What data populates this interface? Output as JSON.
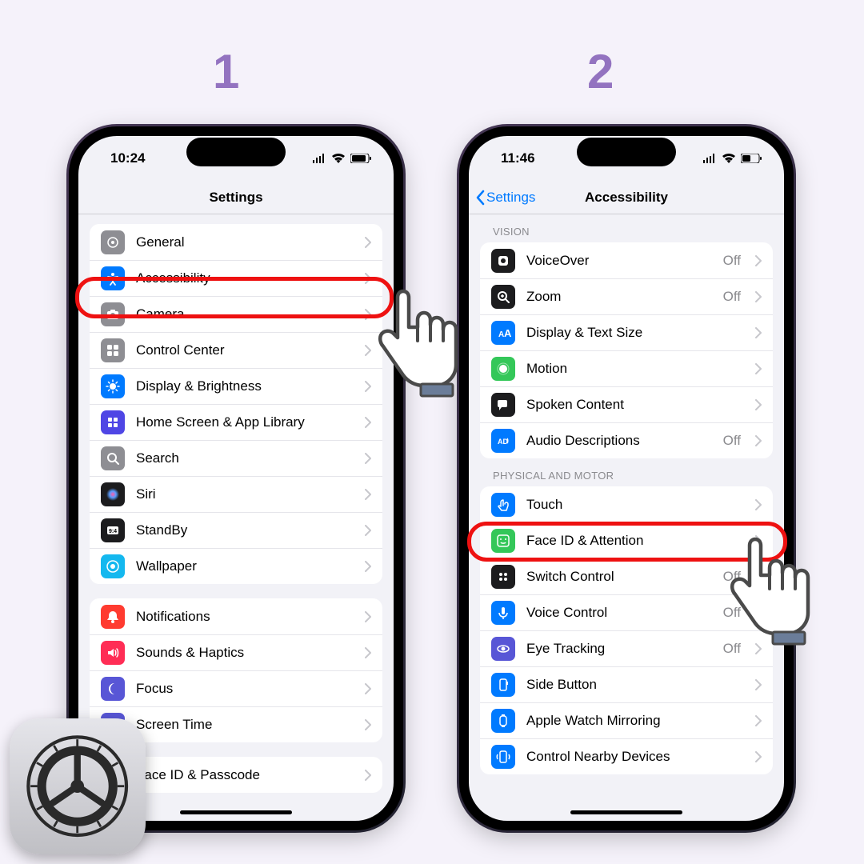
{
  "steps": {
    "one": "1",
    "two": "2"
  },
  "phone1": {
    "time": "10:24",
    "title": "Settings",
    "rows1": [
      {
        "label": "General",
        "iconColor": "#8e8e93"
      },
      {
        "label": "Accessibility",
        "iconColor": "#007aff",
        "highlighted": true
      },
      {
        "label": "Camera",
        "iconColor": "#8e8e93"
      },
      {
        "label": "Control Center",
        "iconColor": "#8e8e93"
      },
      {
        "label": "Display & Brightness",
        "iconColor": "#007aff"
      },
      {
        "label": "Home Screen & App Library",
        "iconColor": "#4f46e5"
      },
      {
        "label": "Search",
        "iconColor": "#8e8e93"
      },
      {
        "label": "Siri",
        "iconColor": "#1c1c1e"
      },
      {
        "label": "StandBy",
        "iconColor": "#1c1c1e"
      },
      {
        "label": "Wallpaper",
        "iconColor": "#14b8ef"
      }
    ],
    "rows2": [
      {
        "label": "Notifications",
        "iconColor": "#ff3b30"
      },
      {
        "label": "Sounds & Haptics",
        "iconColor": "#ff2d55"
      },
      {
        "label": "Focus",
        "iconColor": "#5856d6"
      },
      {
        "label": "Screen Time",
        "iconColor": "#5856d6"
      }
    ],
    "rows3": [
      {
        "label": "Face ID & Passcode",
        "iconColor": "#34c759"
      }
    ]
  },
  "phone2": {
    "time": "11:46",
    "back": "Settings",
    "title": "Accessibility",
    "visionHeader": "VISION",
    "visionRows": [
      {
        "label": "VoiceOver",
        "value": "Off",
        "iconColor": "#1c1c1e"
      },
      {
        "label": "Zoom",
        "value": "Off",
        "iconColor": "#1c1c1e"
      },
      {
        "label": "Display & Text Size",
        "value": "",
        "iconColor": "#007aff"
      },
      {
        "label": "Motion",
        "value": "",
        "iconColor": "#34c759"
      },
      {
        "label": "Spoken Content",
        "value": "",
        "iconColor": "#1c1c1e"
      },
      {
        "label": "Audio Descriptions",
        "value": "Off",
        "iconColor": "#007aff"
      }
    ],
    "motorHeader": "PHYSICAL AND MOTOR",
    "motorRows": [
      {
        "label": "Touch",
        "value": "",
        "iconColor": "#007aff",
        "highlighted": true
      },
      {
        "label": "Face ID & Attention",
        "value": "",
        "iconColor": "#34c759"
      },
      {
        "label": "Switch Control",
        "value": "Off",
        "iconColor": "#1c1c1e"
      },
      {
        "label": "Voice Control",
        "value": "Off",
        "iconColor": "#007aff"
      },
      {
        "label": "Eye Tracking",
        "value": "Off",
        "iconColor": "#5856d6"
      },
      {
        "label": "Side Button",
        "value": "",
        "iconColor": "#007aff"
      },
      {
        "label": "Apple Watch Mirroring",
        "value": "",
        "iconColor": "#007aff"
      },
      {
        "label": "Control Nearby Devices",
        "value": "",
        "iconColor": "#007aff"
      }
    ]
  }
}
